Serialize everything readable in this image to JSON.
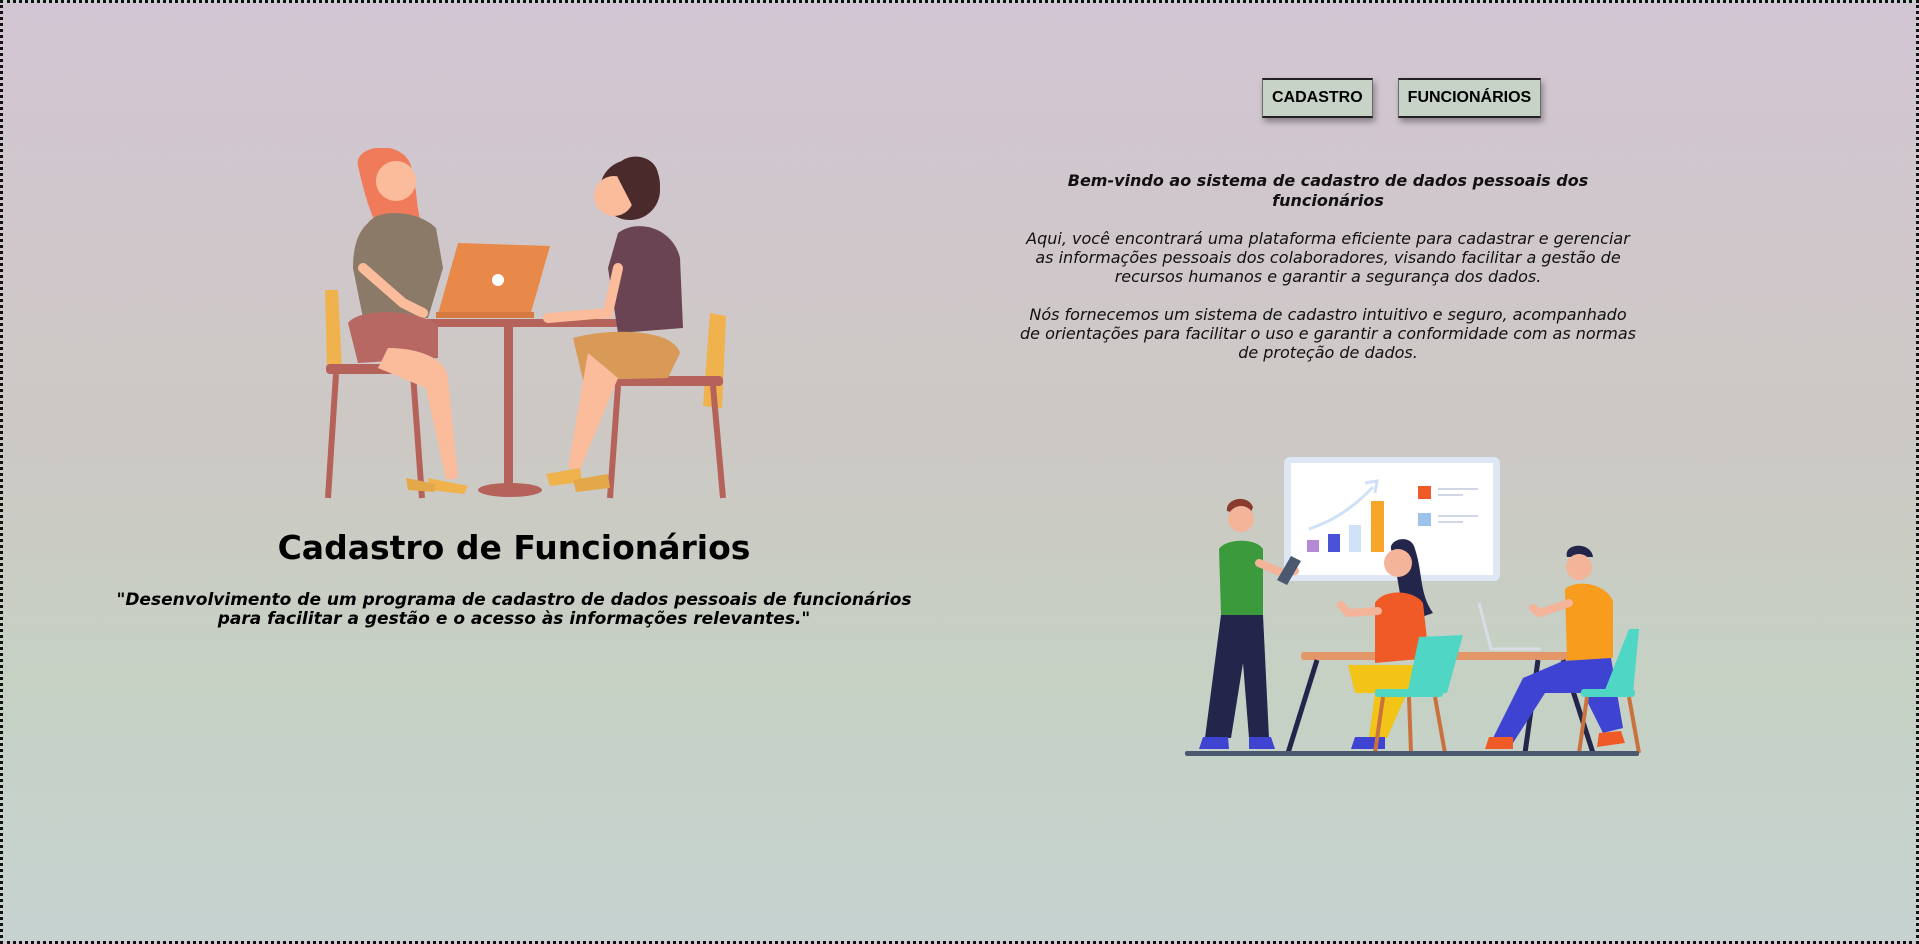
{
  "nav": {
    "cadastro_label": "CADASTRO",
    "funcionarios_label": "FUNCIONÁRIOS"
  },
  "welcome": {
    "title": "Bem-vindo ao sistema de cadastro de dados pessoais dos funcionários",
    "paragraph1": "Aqui, você encontrará uma plataforma eficiente para cadastrar e gerenciar as informações pessoais dos colaboradores, visando facilitar a gestão de recursos humanos e garantir a segurança dos dados.",
    "paragraph2": "Nós fornecemos um sistema de cadastro intuitivo e seguro, acompanhado de orientações para facilitar o uso e garantir a conformidade com as normas de proteção de dados."
  },
  "hero": {
    "title": "Cadastro de Funcionários",
    "subtitle": "\"Desenvolvimento de um programa de cadastro de dados pessoais de funcionários para facilitar a gestão e o acesso às informações relevantes.\""
  },
  "illustrations": {
    "left": "two-women-laptop-illustration",
    "right": "team-meeting-chart-illustration"
  },
  "colors": {
    "background_top": "#d3c6d4",
    "background_bottom": "#c6d2d0",
    "button_bg": "#c7d3c6"
  }
}
